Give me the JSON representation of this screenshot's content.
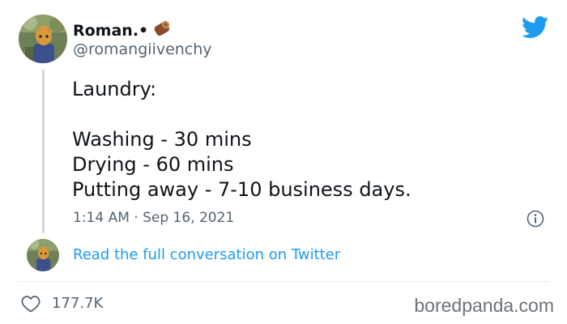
{
  "author": {
    "display_name": "Roman.•",
    "handle": "@romangiivenchy"
  },
  "tweet": {
    "lines": [
      "Laundry:",
      "",
      "Washing - 30 mins",
      "Drying - 60 mins",
      "Putting away - 7-10 business days."
    ],
    "timestamp": "1:14 AM · Sep 16, 2021"
  },
  "conversation_link": "Read the full conversation on Twitter",
  "likes": "177.7K",
  "watermark": "boredpanda.com",
  "colors": {
    "twitter_blue": "#1d9bf0",
    "text_primary": "#0f1419",
    "text_secondary": "#536471",
    "thread_line": "#cfd9de"
  },
  "icons": {
    "brand": "twitter-bird-icon",
    "badge": "log-icon",
    "info": "info-icon",
    "like": "heart-icon"
  }
}
